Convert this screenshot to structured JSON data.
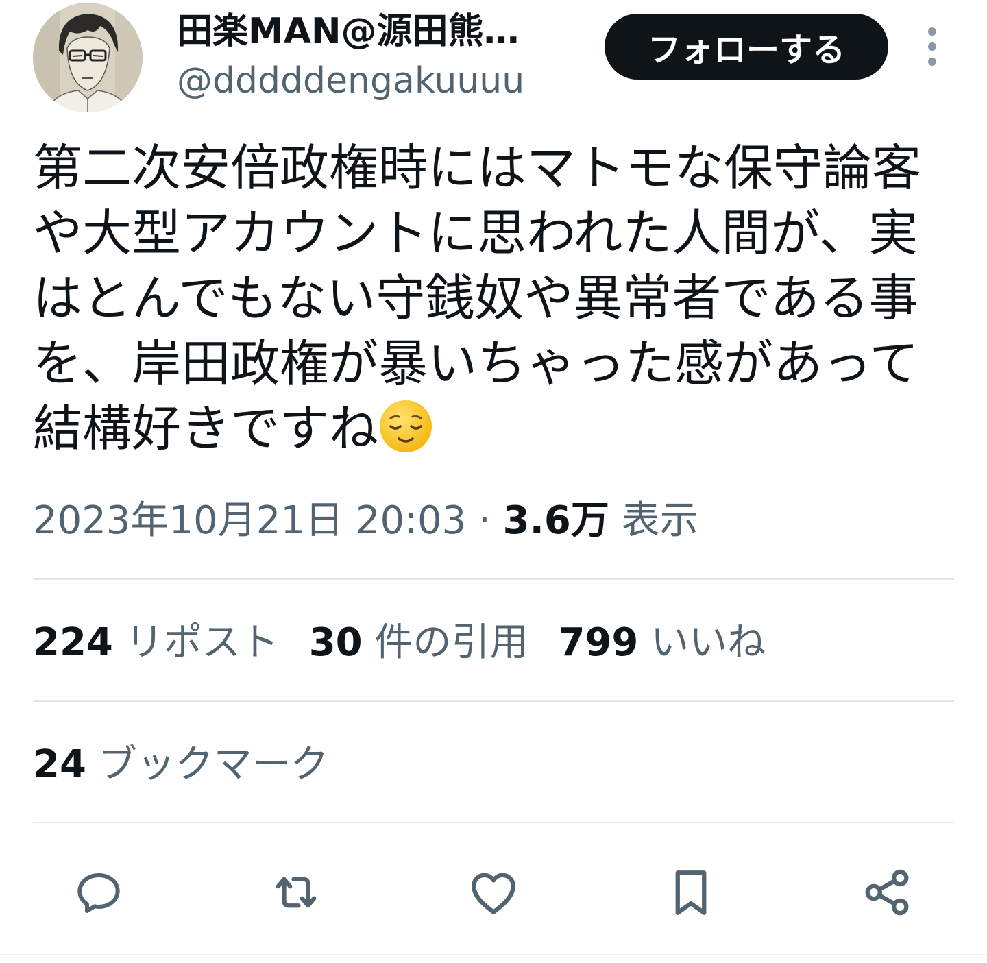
{
  "user": {
    "display_name": "田楽MAN@源田熊…",
    "handle": "@dddddengakuuuu",
    "avatar_icon": "manga-character-avatar"
  },
  "header": {
    "follow_label": "フォローする",
    "more_icon": "more-vertical-icon"
  },
  "tweet": {
    "text": "第二次安倍政権時にはマトモな保守論客や大型アカウントに思われた人間が、実はとんでもない守銭奴や異常者である事を、岸田政権が暴いちゃった感があって結構好きですね",
    "emoji": "relieved-face-emoji",
    "timestamp": "2023年10月21日 20:03",
    "separator": " · ",
    "views_count": "3.6万",
    "views_label": " 表示"
  },
  "stats": {
    "reposts_count": "224",
    "reposts_label": " リポスト",
    "quotes_count": "30",
    "quotes_label": " 件の引用",
    "likes_count": "799",
    "likes_label": " いいね",
    "bookmarks_count": "24",
    "bookmarks_label": " ブックマーク"
  },
  "actions": {
    "icons": [
      "reply-icon",
      "retweet-icon",
      "like-icon",
      "bookmark-icon",
      "share-icon"
    ],
    "icon_color": "#536471"
  },
  "colors": {
    "text_primary": "#0f1419",
    "text_secondary": "#536471",
    "divider": "#e1e6ea",
    "button_bg": "#0f1419",
    "button_text": "#ffffff"
  }
}
